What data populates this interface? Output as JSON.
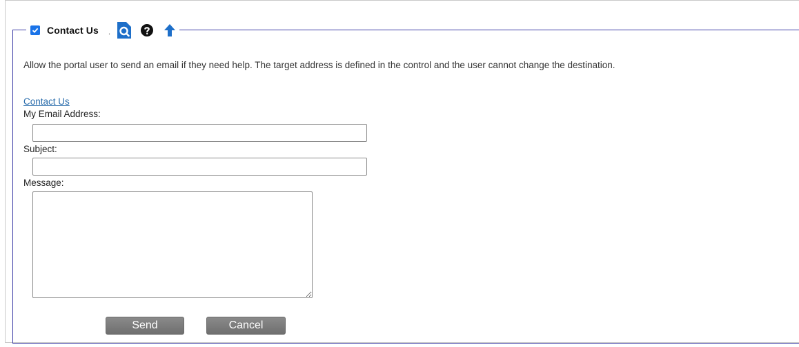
{
  "section": {
    "title": "Contact Us",
    "enabled": true,
    "dot": ".",
    "icons": [
      "preview-icon",
      "help-icon",
      "move-up-icon"
    ]
  },
  "description": "Allow the portal user to send an email if they need help. The target address is defined in the control and the user cannot change the destination.",
  "form": {
    "link_text": "Contact Us",
    "email_label": "My Email Address:",
    "email_value": "",
    "subject_label": "Subject:",
    "subject_value": "",
    "message_label": "Message:",
    "message_value": "",
    "send_label": "Send",
    "cancel_label": "Cancel"
  },
  "colors": {
    "accent": "#1a73e8",
    "fieldset_border": "#3a3aa6",
    "link": "#2a6dac",
    "button": "#7a7a7a"
  }
}
